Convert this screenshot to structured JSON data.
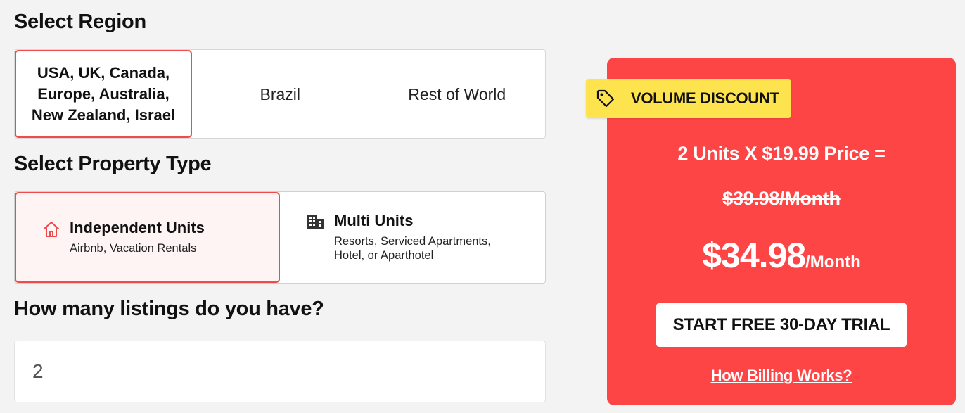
{
  "headings": {
    "region": "Select Region",
    "property_type": "Select Property Type",
    "listings": "How many listings do you have?"
  },
  "regions": [
    {
      "label": "USA, UK, Canada, Europe, Australia, New Zealand, Israel",
      "selected": true
    },
    {
      "label": "Brazil",
      "selected": false
    },
    {
      "label": "Rest of World",
      "selected": false
    }
  ],
  "property_types": [
    {
      "title": "Independent Units",
      "subtitle": "Airbnb, Vacation Rentals",
      "icon": "house-icon",
      "selected": true
    },
    {
      "title": "Multi Units",
      "subtitle": "Resorts, Serviced Apartments, Hotel, or Aparthotel",
      "icon": "building-icon",
      "selected": false
    }
  ],
  "listings_input": {
    "value": "2"
  },
  "pricing": {
    "badge": "VOLUME DISCOUNT",
    "badge_icon": "tag-icon",
    "calculation": "2 Units X $19.99 Price =",
    "original_price": "$39.98/Month",
    "discounted_amount": "$34.98",
    "discounted_period": "/Month",
    "cta": "START FREE 30-DAY TRIAL",
    "billing_link": "How Billing Works?"
  },
  "colors": {
    "accent_red": "#fe4545",
    "badge_yellow": "#fde34e",
    "selected_border": "#ef4b4b"
  }
}
